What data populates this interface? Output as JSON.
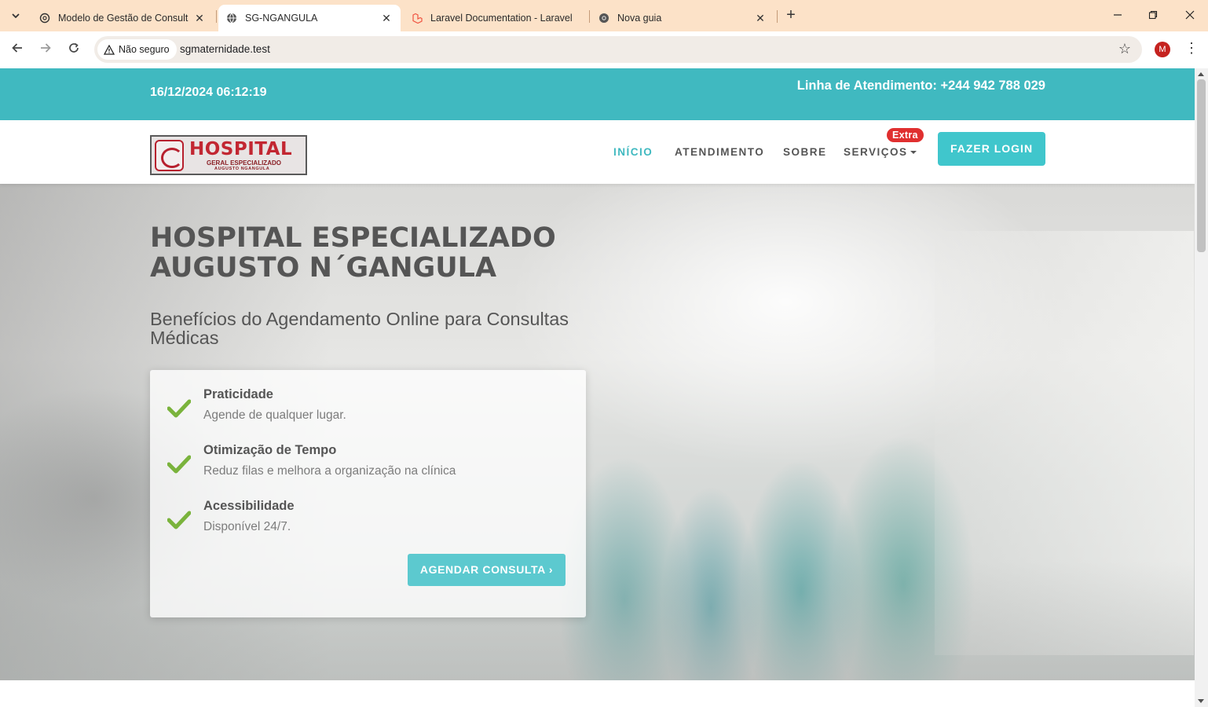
{
  "browser": {
    "tabs": [
      {
        "title": "Modelo de Gestão de Consultas",
        "favicon": "chatgpt-icon",
        "active": false
      },
      {
        "title": "SG-NGANGULA",
        "favicon": "globe-icon",
        "active": true
      },
      {
        "title": "Laravel Documentation - Laravel",
        "favicon": "laravel-icon",
        "active": false
      },
      {
        "title": "Nova guia",
        "favicon": "chrome-icon",
        "active": false
      }
    ],
    "security_label": "Não seguro",
    "url": "sgmaternidade.test",
    "profile_initial": "M"
  },
  "topbar": {
    "datetime": "16/12/2024 06:12:19",
    "hotline": "Linha de Atendimento: +244 942 788 029"
  },
  "logo": {
    "line1": "HOSPITAL",
    "line2": "GERAL ESPECIALIZADO",
    "line3": "AUGUSTO NGANGULA"
  },
  "nav": {
    "items": [
      "INÍCIO",
      "ATENDIMENTO",
      "SOBRE",
      "SERVIÇOS"
    ],
    "active_index": 0,
    "badge": "Extra",
    "login": "FAZER LOGIN"
  },
  "hero": {
    "title_line1": "HOSPITAL ESPECIALIZADO",
    "title_line2": "AUGUSTO N´GANGULA",
    "subtitle": "Benefícios do Agendamento Online para Consultas Médicas",
    "benefits": [
      {
        "title": "Praticidade",
        "desc": "Agende de qualquer lugar."
      },
      {
        "title": "Otimização de Tempo",
        "desc": "Reduz filas e melhora a organização na clínica"
      },
      {
        "title": "Acessibilidade",
        "desc": "Disponível 24/7."
      }
    ],
    "cta": "AGENDAR CONSULTA ›"
  },
  "colors": {
    "teal": "#40b9c0",
    "button": "#40c6cc",
    "badge": "#e02f2f",
    "check": "#7ab33c",
    "tabbar": "#fce2c8"
  }
}
